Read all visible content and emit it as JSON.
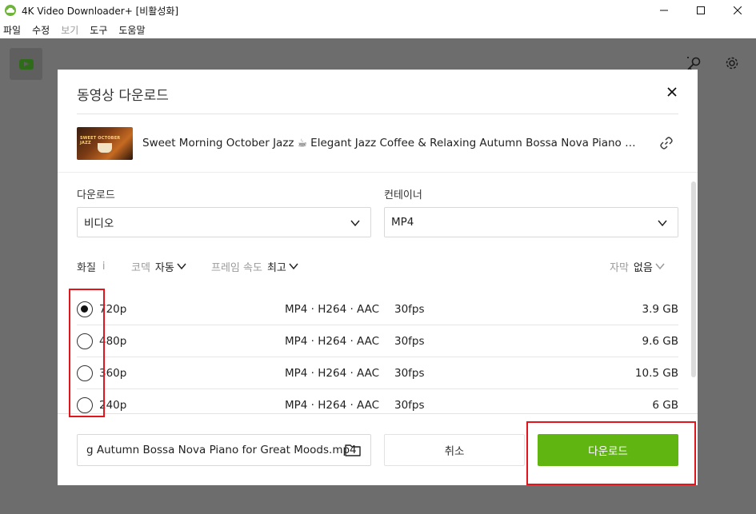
{
  "window": {
    "title": "4K Video Downloader+ [비활성화]",
    "controls": [
      "—",
      "☐",
      "✕"
    ]
  },
  "menu": [
    {
      "label": "파일",
      "disabled": false
    },
    {
      "label": "수정",
      "disabled": false
    },
    {
      "label": "보기",
      "disabled": true
    },
    {
      "label": "도구",
      "disabled": false
    },
    {
      "label": "도움말",
      "disabled": false
    }
  ],
  "icons": {
    "app": "app-cloud-icon",
    "youtube_tab": "youtube-icon",
    "smart_mode": "smart-mode-icon",
    "settings": "gear-icon",
    "close": "close-icon",
    "link": "link-icon",
    "folder": "folder-icon",
    "chevron": "chevron-down-icon"
  },
  "dialog": {
    "title": "동영상 다운로드",
    "video": {
      "thumbnail_text": "SWEET OCTOBER JAZZ",
      "title": "Sweet Morning October Jazz ☕ Elegant Jazz Coffee & Relaxing Autumn Bossa Nova Piano for Great Moods"
    },
    "download_label": "다운로드",
    "download_value": "비디오",
    "container_label": "컨테이너",
    "container_value": "MP4",
    "options": {
      "quality_label": "화질",
      "quality_info": "i",
      "codec_label": "코덱",
      "codec_value": "자동",
      "framerate_label": "프레임 속도",
      "framerate_value": "최고",
      "subtitles_label": "자막",
      "subtitles_value": "없음"
    },
    "resolutions": [
      {
        "name": "720p",
        "codec": "MP4 · H264 · AAC",
        "fps": "30fps",
        "size": "3.9 GB",
        "selected": true
      },
      {
        "name": "480p",
        "codec": "MP4 · H264 · AAC",
        "fps": "30fps",
        "size": "9.6 GB",
        "selected": false
      },
      {
        "name": "360p",
        "codec": "MP4 · H264 · AAC",
        "fps": "30fps",
        "size": "10.5 GB",
        "selected": false
      },
      {
        "name": "240p",
        "codec": "MP4 · H264 · AAC",
        "fps": "30fps",
        "size": "6 GB",
        "selected": false
      }
    ],
    "file_path": "g Autumn Bossa Nova Piano for Great Moods.mp4",
    "cancel_label": "취소",
    "download_button_label": "다운로드"
  },
  "colors": {
    "accent_green": "#61b511",
    "highlight_red": "#e3141b",
    "overlay": "#6d6d6d"
  }
}
